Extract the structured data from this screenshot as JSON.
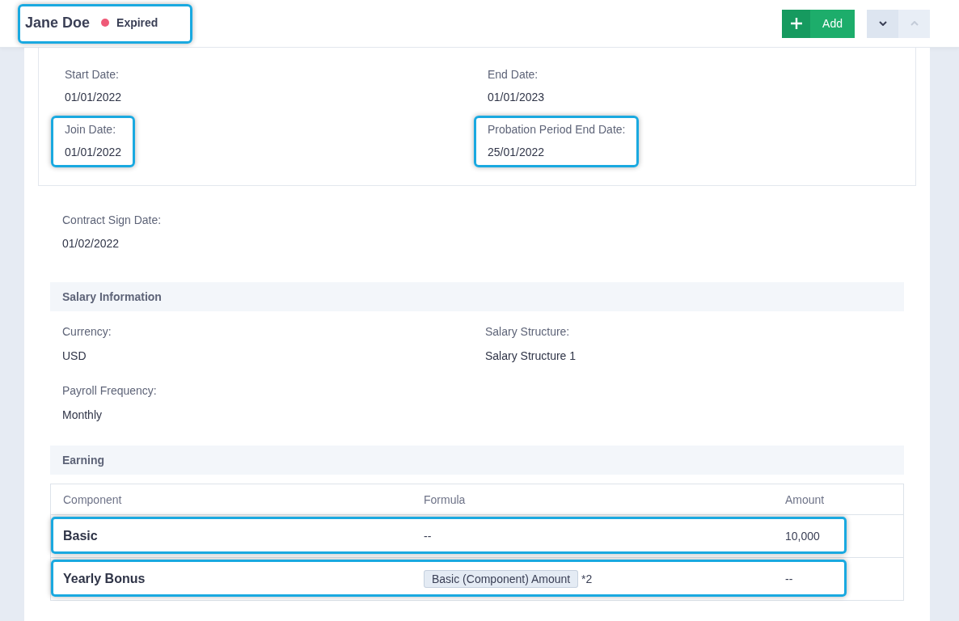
{
  "header": {
    "name": "Jane Doe",
    "status": {
      "label": "Expired",
      "color": "#ef5a78"
    },
    "highlighted": true,
    "add_button": "Add",
    "nav": [
      {
        "kind": "down",
        "disabled": false
      },
      {
        "kind": "up",
        "disabled": true
      }
    ]
  },
  "contract_dates": [
    {
      "label": "Start Date:",
      "value": "01/01/2022",
      "highlighted": false
    },
    {
      "label": "End Date:",
      "value": "01/01/2023",
      "highlighted": false
    },
    {
      "label": "Join Date:",
      "value": "01/01/2022",
      "highlighted": true
    },
    {
      "label": "Probation Period End Date:",
      "value": "25/01/2022",
      "highlighted": true
    }
  ],
  "contract_sign": {
    "label": "Contract Sign Date:",
    "value": "01/02/2022"
  },
  "salary_information": {
    "title": "Salary Information",
    "fields": [
      {
        "label": "Currency:",
        "value": "USD"
      },
      {
        "label": "Salary Structure:",
        "value": "Salary Structure 1"
      },
      {
        "label": "Payroll Frequency:",
        "value": "Monthly"
      }
    ]
  },
  "earning": {
    "title": "Earning",
    "columns": [
      "Component",
      "Formula",
      "Amount"
    ],
    "rows": [
      {
        "component": "Basic",
        "formula": {
          "kind": "text",
          "text": "--"
        },
        "amount": "10,000",
        "highlighted": true
      },
      {
        "component": "Yearly Bonus",
        "formula": {
          "kind": "tag",
          "tag": "Basic (Component) Amount",
          "suffix": "*2"
        },
        "amount": "--",
        "highlighted": true
      }
    ]
  }
}
